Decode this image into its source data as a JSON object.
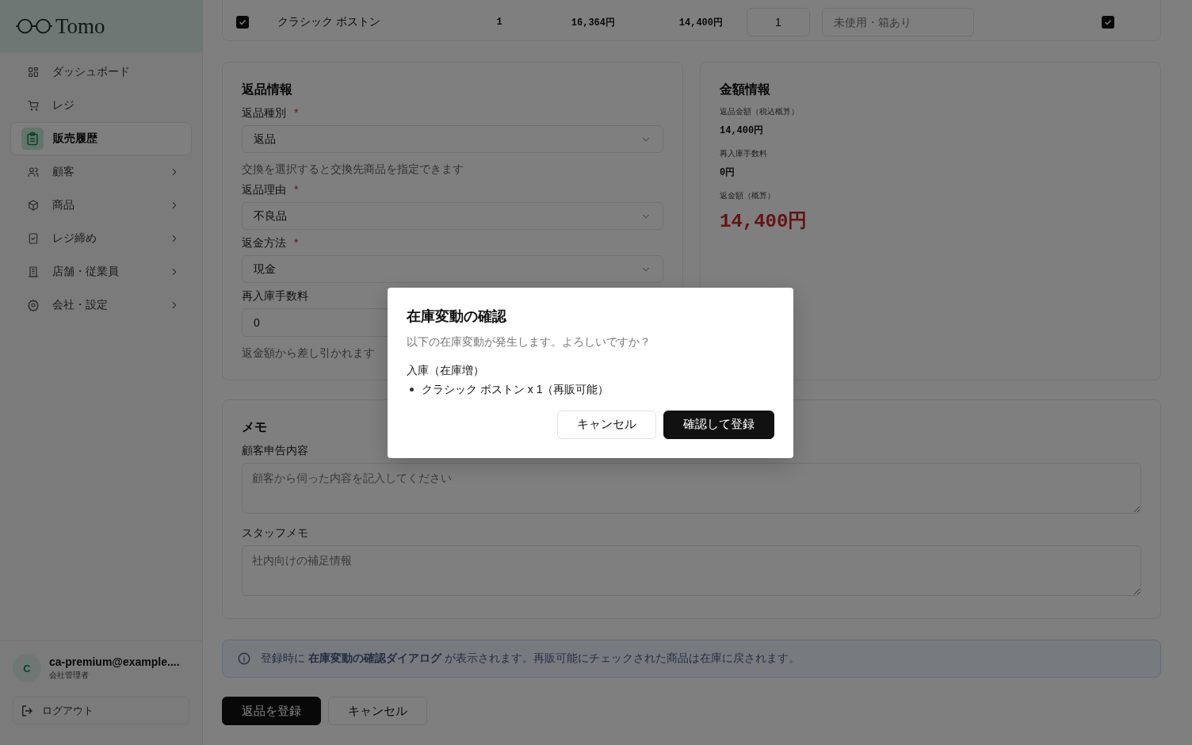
{
  "sidebar": {
    "logo": "Tomo",
    "nav": [
      {
        "label": "ダッシュボード",
        "selected": false,
        "expandable": false
      },
      {
        "label": "レジ",
        "selected": false,
        "expandable": false
      },
      {
        "label": "販売履歴",
        "selected": true,
        "expandable": false
      },
      {
        "label": "顧客",
        "selected": false,
        "expandable": true
      },
      {
        "label": "商品",
        "selected": false,
        "expandable": true
      },
      {
        "label": "レジ締め",
        "selected": false,
        "expandable": true
      },
      {
        "label": "店舗・従業員",
        "selected": false,
        "expandable": true
      },
      {
        "label": "会社・設定",
        "selected": false,
        "expandable": true
      }
    ],
    "user": {
      "avatar": "C",
      "email": "ca-premium@example....",
      "role": "会社管理者"
    },
    "logout": "ログアウト"
  },
  "item_row": {
    "checked": true,
    "name": "クラシック ボストン",
    "purchased_qty": "1",
    "unit_price": "16,364円",
    "return_price": "14,400円",
    "return_qty": "1",
    "condition_placeholder": "未使用・箱あり",
    "resellable": true
  },
  "return_info": {
    "title": "返品情報",
    "fields": [
      {
        "kind": "select",
        "label": "返品種別",
        "required_mark": "*",
        "value": "返品",
        "hint": "交換を選択すると交換先商品を指定できます"
      },
      {
        "kind": "select",
        "label": "返品理由",
        "required_mark": "*",
        "value": "不良品"
      },
      {
        "kind": "select",
        "label": "返金方法",
        "required_mark": "*",
        "value": "現金"
      },
      {
        "kind": "input",
        "label": "再入庫手数料",
        "value": "0",
        "hint": "返金額から差し引かれます"
      }
    ]
  },
  "amount_info": {
    "title": "金額情報",
    "rows": [
      {
        "label": "返品金額（税込概算）",
        "value": "14,400円",
        "kind": "normal"
      },
      {
        "label": "再入庫手数料",
        "value": "0円",
        "kind": "normal"
      },
      {
        "label": "返金額（概算）",
        "value": "14,400円",
        "kind": "total"
      }
    ]
  },
  "memo": {
    "title": "メモ",
    "fields": [
      {
        "label": "顧客申告内容",
        "placeholder": "顧客から伺った内容を記入してください"
      },
      {
        "label": "スタッフメモ",
        "placeholder": "社内向けの補足情報"
      }
    ]
  },
  "notice": "登録時に **在庫変動の確認ダイアログ** が表示されます。再販可能にチェックされた商品は在庫に戻されます。",
  "actions": [
    {
      "label": "返品を登録",
      "kind": "primary"
    },
    {
      "label": "キャンセル",
      "kind": "secondary"
    }
  ],
  "dialog": {
    "title": "在庫変動の確認",
    "message": "以下の在庫変動が発生します。よろしいですか？",
    "section": "入庫（在庫増）",
    "items": [
      "クラシック ボストン x 1（再販可能）"
    ],
    "buttons": [
      {
        "label": "キャンセル",
        "kind": "secondary"
      },
      {
        "label": "確認して登録",
        "kind": "primary"
      }
    ]
  }
}
